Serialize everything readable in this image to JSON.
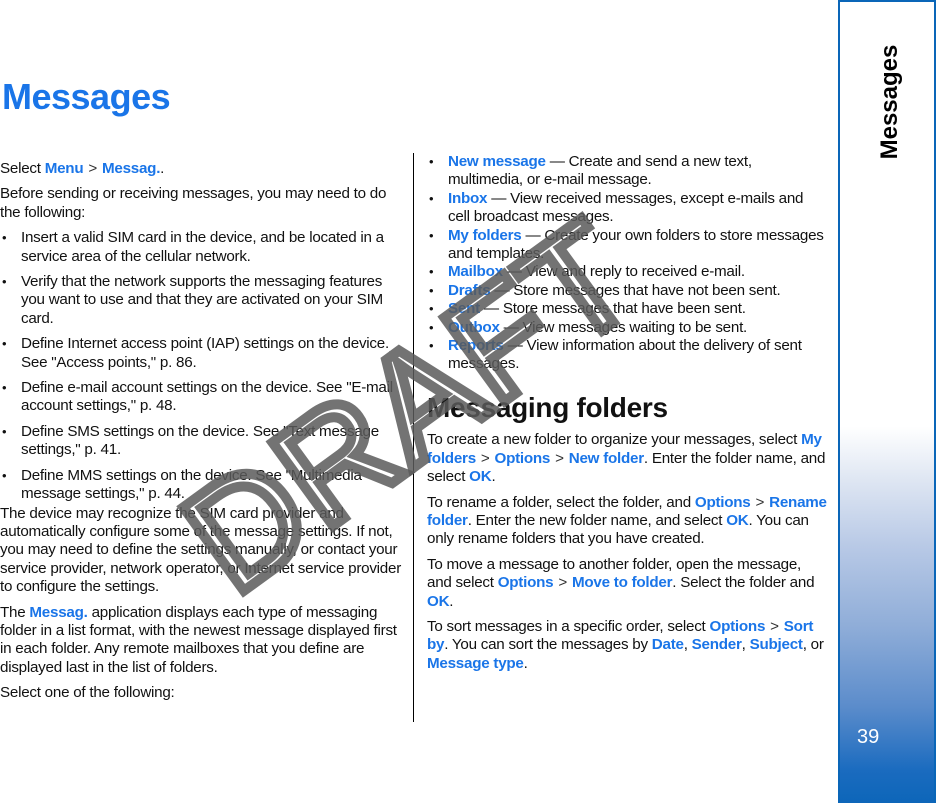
{
  "page": {
    "title": "Messages",
    "number": "39",
    "side_tab_label": "Messages",
    "watermark": "DRAFT",
    "accent_color": "#1a75e8",
    "tab_color": "#0d66b9"
  },
  "left": {
    "intro": {
      "select": "Select",
      "menu": "Menu",
      "sep": ">",
      "messag": "Messag.",
      "end": "."
    },
    "before": "Before sending or receiving messages, you may need to do the following:",
    "steps": [
      "Insert a valid SIM card in the device, and be located in a service area of the cellular network.",
      "Verify that the network supports the messaging features you want to use and that they are activated on your SIM card.",
      "Define Internet access point (IAP) settings on the device. See \"Access points,\" p. 86.",
      "Define e-mail account settings on the device. See \"E-mail account settings,\" p. 48.",
      "Define SMS settings on the device. See \"Text message settings,\" p. 41.",
      "Define MMS settings on the device. See \"Multimedia message settings,\" p. 44."
    ],
    "sim_para": "The device may recognize the SIM card provider and automatically configure some of the message settings. If not, you may need to define the settings manually, or contact your service provider, network operator, or Internet service provider to configure the settings.",
    "app_para": {
      "pre": "The",
      "link": "Messag.",
      "post": "application displays each type of messaging folder in a list format, with the newest message displayed first in each folder. Any remote mailboxes that you define are displayed last in the list of folders."
    },
    "select_one": "Select one of the following:"
  },
  "right": {
    "folders": [
      {
        "name": "New message",
        "desc": "— Create and send a new text, multimedia, or e-mail message."
      },
      {
        "name": "Inbox",
        "desc": "— View received messages, except e-mails and cell broadcast messages."
      },
      {
        "name": "My folders",
        "desc": "— Create your own folders to store messages and templates."
      },
      {
        "name": "Mailbox",
        "desc": "— View and reply to received e-mail."
      },
      {
        "name": "Drafts",
        "desc": "— Store messages that have not been sent."
      },
      {
        "name": "Sent",
        "desc": "— Store messages that have been sent."
      },
      {
        "name": "Outbox",
        "desc": "— View messages waiting to be sent."
      },
      {
        "name": "Reports",
        "desc": "— View information about the delivery of sent messages."
      }
    ],
    "heading": "Messaging folders",
    "create": {
      "pre": "To create a new folder to organize your messages, select",
      "l1": "My folders",
      "l2": "Options",
      "l3": "New folder",
      "mid": ". Enter the folder name, and select",
      "ok": "OK",
      "end": "."
    },
    "rename": {
      "pre": "To rename a folder, select the folder, and",
      "l1": "Options",
      "l2": "Rename folder",
      "mid": ". Enter the new folder name, and select",
      "ok": "OK",
      "end": ". You can only rename folders that you have created."
    },
    "move": {
      "pre": "To move a message to another folder, open the message, and select",
      "l1": "Options",
      "l2": "Move to folder",
      "mid": ". Select the folder and",
      "ok": "OK",
      "end": "."
    },
    "sort": {
      "pre": "To sort messages in a specific order, select",
      "l1": "Options",
      "l2": "Sort by",
      "mid": ". You can sort the messages by",
      "o1": "Date",
      "o2": "Sender",
      "o3": "Subject",
      "or": ", or",
      "o4": "Message type",
      "end": "."
    },
    "sep": ">"
  }
}
